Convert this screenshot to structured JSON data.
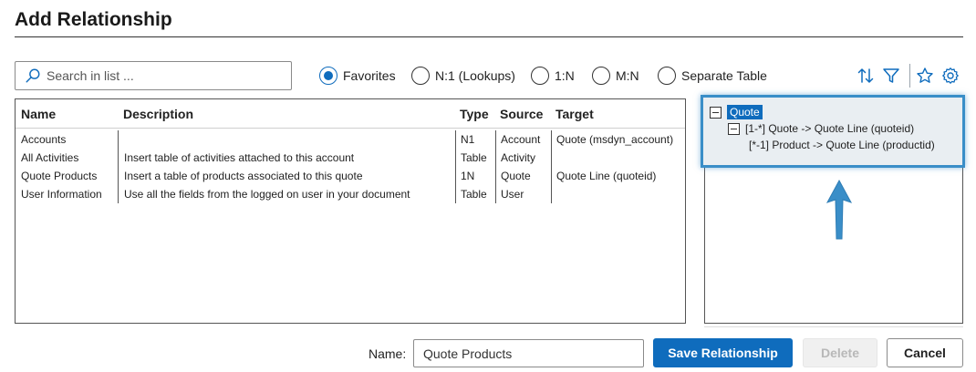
{
  "header": {
    "title": "Add Relationship"
  },
  "search": {
    "placeholder": "Search in list ..."
  },
  "filters": {
    "options": [
      {
        "label": "Favorites",
        "selected": true
      },
      {
        "label": "N:1 (Lookups)",
        "selected": false
      },
      {
        "label": "1:N",
        "selected": false
      },
      {
        "label": "M:N",
        "selected": false
      },
      {
        "label": "Separate Table",
        "selected": false
      }
    ]
  },
  "toolbar": {
    "icons": [
      "sort-icon",
      "filter-icon",
      "star-icon",
      "gear-icon"
    ],
    "accent_color": "#0f6cbd"
  },
  "list": {
    "columns": [
      "Name",
      "Description",
      "Type",
      "Source",
      "Target"
    ],
    "rows": [
      {
        "name": "Accounts",
        "description": "",
        "type": "N1",
        "source": "Account",
        "target": "Quote (msdyn_account)"
      },
      {
        "name": "All Activities",
        "description": "Insert table of activities attached to this account",
        "type": "Table",
        "source": "Activity",
        "target": ""
      },
      {
        "name": "Quote Products",
        "description": "Insert a table of products associated to this quote",
        "type": "1N",
        "source": "Quote",
        "target": "Quote Line (quoteid)"
      },
      {
        "name": "User Information",
        "description": "Use all the fields from the logged on user in your document",
        "type": "Table",
        "source": "User",
        "target": ""
      }
    ]
  },
  "tree": {
    "root": "Quote",
    "children": [
      "[1-*] Quote -> Quote Line (quoteid)",
      "[*-1] Product -> Quote Line (productid)"
    ],
    "highlight_color": "#3a8ec8"
  },
  "footer": {
    "name_label": "Name:",
    "name_value": "Quote Products",
    "save_label": "Save Relationship",
    "delete_label": "Delete",
    "cancel_label": "Cancel"
  }
}
